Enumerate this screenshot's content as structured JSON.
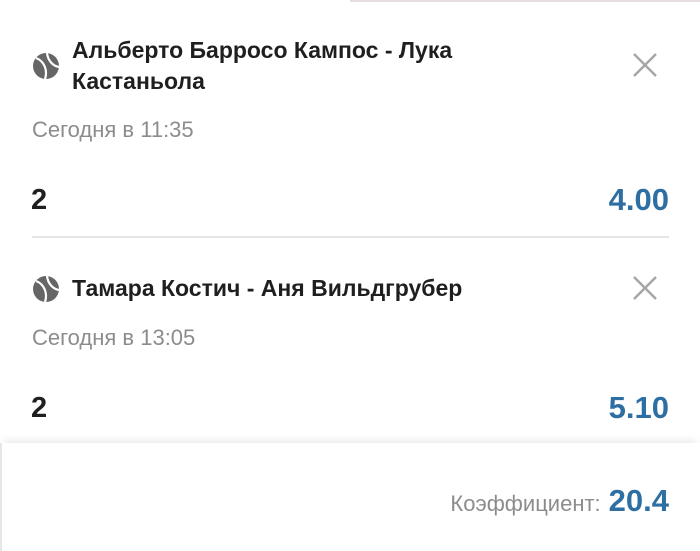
{
  "bets": [
    {
      "sport_icon": "tennis-ball-icon",
      "title": "Альберто Барросо Кампос - Лука Кастаньола",
      "time": "Сегодня в 11:35",
      "outcome": "2",
      "odds": "4.00"
    },
    {
      "sport_icon": "tennis-ball-icon",
      "title": "Тамара Костич - Аня Вильдгрубер",
      "time": "Сегодня в 13:05",
      "outcome": "2",
      "odds": "5.10"
    }
  ],
  "summary": {
    "coefficient_label": "Коэффициент:",
    "coefficient_value": "20.4"
  },
  "colors": {
    "odds": "#2e6fa3",
    "text": "#1f1f1f",
    "muted": "#8c8c8c"
  }
}
